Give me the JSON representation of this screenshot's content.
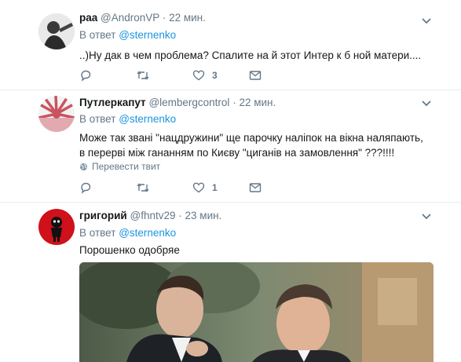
{
  "tweets": [
    {
      "name": "раа",
      "handle": "@AndronVP",
      "sep": "·",
      "time": "22 мин.",
      "reply_prefix": "В ответ",
      "reply_to": "@sternenko",
      "text": "..)Ну дак в чем проблема? Спалите на  й этот Интер к  б ной матери....",
      "reply_count": "",
      "retweet_count": "",
      "like_count": "3"
    },
    {
      "name": "Путлеркапут",
      "handle": "@lembergcontrol",
      "sep": "·",
      "time": "22 мин.",
      "reply_prefix": "В ответ",
      "reply_to": "@sternenko",
      "text": "Може так звані \"нацдружини\" ще парочку наліпок на вікна наляпають, в перерві між гананням по Києву \"циганів на замовлення\" ???!!!!",
      "translate_label": "Перевести твит",
      "reply_count": "",
      "retweet_count": "",
      "like_count": "1"
    },
    {
      "name": "григорий",
      "handle": "@fhntv29",
      "sep": "·",
      "time": "23 мин.",
      "reply_prefix": "В ответ",
      "reply_to": "@sternenko",
      "text": "Порошенко одобряе"
    }
  ],
  "colors": {
    "text": "#14171a",
    "muted": "#657786",
    "link": "#1b95e0",
    "divider": "#e6ecf0"
  },
  "icons": [
    "reply-icon",
    "retweet-icon",
    "like-icon",
    "direct-message-icon",
    "chevron-down-icon",
    "globe-icon"
  ]
}
